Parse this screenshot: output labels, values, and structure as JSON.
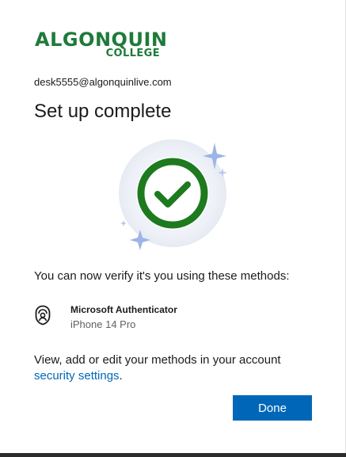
{
  "logo": {
    "line1": "ALGONQUIN",
    "line2": "COLLEGE",
    "color": "#1e7a3a"
  },
  "account": {
    "email": "desk5555@algonquinlive.com"
  },
  "heading": {
    "title": "Set up complete"
  },
  "illustration": {
    "icon": "checkmark-circle-icon",
    "ring_color": "#1e7a1e"
  },
  "methods": {
    "description": "You can now verify it's you using these methods:",
    "items": [
      {
        "name": "Microsoft Authenticator",
        "device": "iPhone 14 Pro",
        "icon": "authenticator-lock-icon"
      }
    ]
  },
  "manage": {
    "text_before": "View, add or edit your methods in your account ",
    "link_label": "security settings",
    "text_after": "."
  },
  "actions": {
    "done_label": "Done",
    "accent_color": "#0067b8"
  }
}
